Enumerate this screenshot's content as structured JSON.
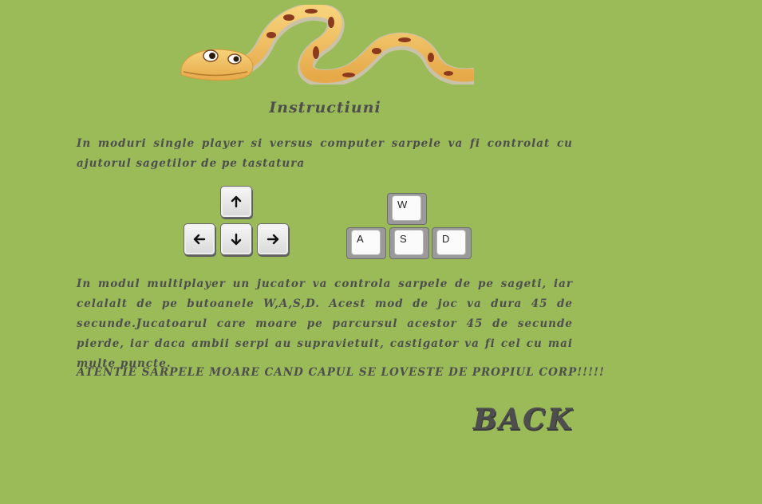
{
  "title": "Instructiuni",
  "paragraph_single": "In moduri single player si versus computer sarpele va fi controlat cu ajutorul sagetilor de pe tastatura",
  "paragraph_multi": "In modul multiplayer un jucator va controla sarpele de pe sageti, iar celalalt de pe butoanele W,A,S,D. Acest mod de joc va dura 45 de secunde.Jucatoarul care moare pe parcursul acestor 45 de secunde pierde, iar daca ambii serpi au supravietuit, castigator va fi cel cu mai multe puncte.",
  "warning": "ATENTIE SARPELE MOARE CAND CAPUL SE LOVESTE DE PROPIUL CORP!!!!!",
  "arrow_keys": {
    "up": "arrow-up-icon",
    "left": "arrow-left-icon",
    "down": "arrow-down-icon",
    "right": "arrow-right-icon"
  },
  "wasd_keys": {
    "w": "W",
    "a": "A",
    "s": "S",
    "d": "D"
  },
  "back_label": "BACK",
  "colors": {
    "background": "#9bbb59",
    "text": "#4e4e4e",
    "snake_body": "#f0c25e",
    "snake_spots": "#8b3a1e"
  }
}
